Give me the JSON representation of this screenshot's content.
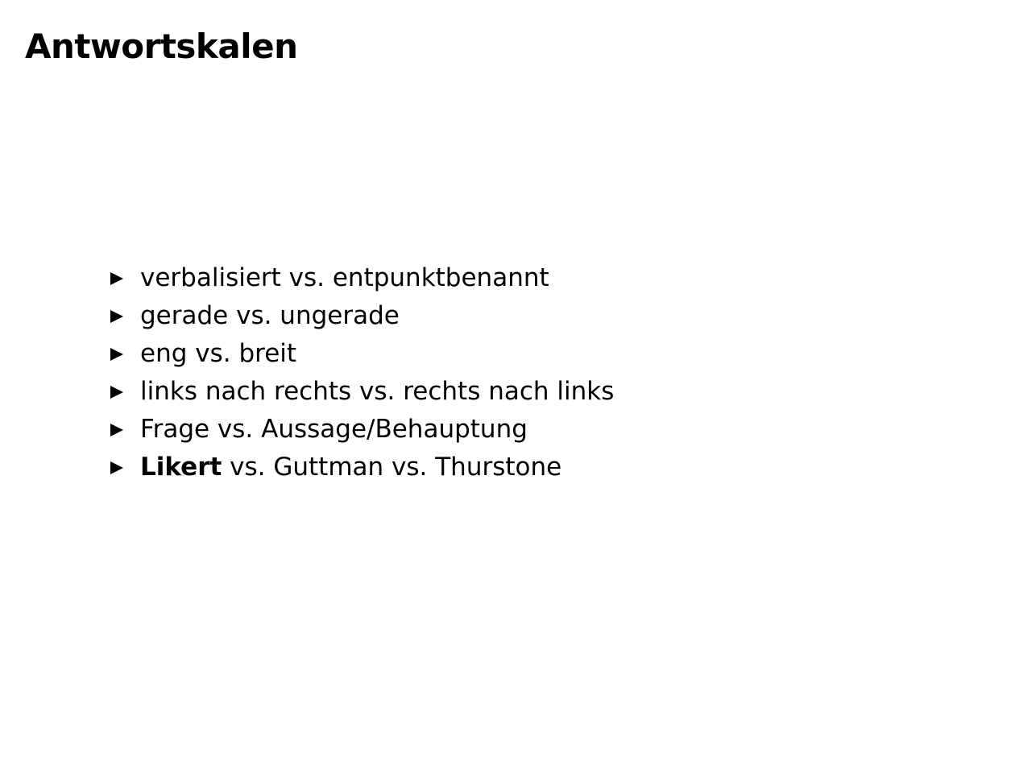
{
  "slide": {
    "title": "Antwortskalen",
    "bullets": [
      "verbalisiert vs. entpunktbenannt",
      "gerade vs. ungerade",
      "eng vs. breit",
      "links nach rechts vs. rechts nach links",
      "Frage vs. Aussage/Behauptung"
    ],
    "last_bullet": {
      "bold": "Likert",
      "rest": " vs. Guttman vs. Thurstone"
    },
    "bullet_icon": "triangle-right-icon"
  }
}
